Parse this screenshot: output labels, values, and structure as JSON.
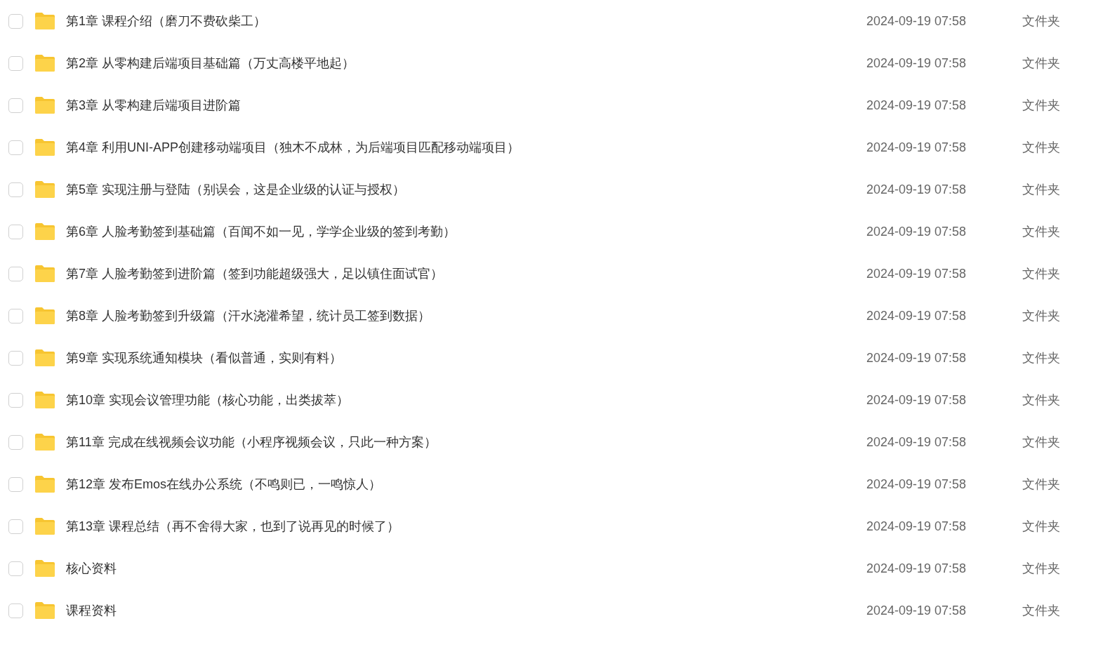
{
  "files": [
    {
      "name": "第1章 课程介绍（磨刀不费砍柴工）",
      "modified": "2024-09-19 07:58",
      "type": "文件夹",
      "checked": false
    },
    {
      "name": "第2章 从零构建后端项目基础篇（万丈高楼平地起）",
      "modified": "2024-09-19 07:58",
      "type": "文件夹",
      "checked": false
    },
    {
      "name": "第3章 从零构建后端项目进阶篇",
      "modified": "2024-09-19 07:58",
      "type": "文件夹",
      "checked": false
    },
    {
      "name": "第4章 利用UNI-APP创建移动端项目（独木不成林，为后端项目匹配移动端项目）",
      "modified": "2024-09-19 07:58",
      "type": "文件夹",
      "checked": false
    },
    {
      "name": "第5章 实现注册与登陆（别误会，这是企业级的认证与授权）",
      "modified": "2024-09-19 07:58",
      "type": "文件夹",
      "checked": false
    },
    {
      "name": "第6章 人脸考勤签到基础篇（百闻不如一见，学学企业级的签到考勤）",
      "modified": "2024-09-19 07:58",
      "type": "文件夹",
      "checked": false
    },
    {
      "name": "第7章 人脸考勤签到进阶篇（签到功能超级强大，足以镇住面试官）",
      "modified": "2024-09-19 07:58",
      "type": "文件夹",
      "checked": false
    },
    {
      "name": "第8章 人脸考勤签到升级篇（汗水浇灌希望，统计员工签到数据）",
      "modified": "2024-09-19 07:58",
      "type": "文件夹",
      "checked": false
    },
    {
      "name": "第9章 实现系统通知模块（看似普通，实则有料）",
      "modified": "2024-09-19 07:58",
      "type": "文件夹",
      "checked": false
    },
    {
      "name": "第10章 实现会议管理功能（核心功能，出类拔萃）",
      "modified": "2024-09-19 07:58",
      "type": "文件夹",
      "checked": false
    },
    {
      "name": "第11章 完成在线视频会议功能（小程序视频会议，只此一种方案）",
      "modified": "2024-09-19 07:58",
      "type": "文件夹",
      "checked": false
    },
    {
      "name": "第12章 发布Emos在线办公系统（不鸣则已，一鸣惊人）",
      "modified": "2024-09-19 07:58",
      "type": "文件夹",
      "checked": false
    },
    {
      "name": "第13章 课程总结（再不舍得大家，也到了说再见的时候了）",
      "modified": "2024-09-19 07:58",
      "type": "文件夹",
      "checked": false
    },
    {
      "name": "核心资料",
      "modified": "2024-09-19 07:58",
      "type": "文件夹",
      "checked": false
    },
    {
      "name": "课程资料",
      "modified": "2024-09-19 07:58",
      "type": "文件夹",
      "checked": false
    }
  ]
}
